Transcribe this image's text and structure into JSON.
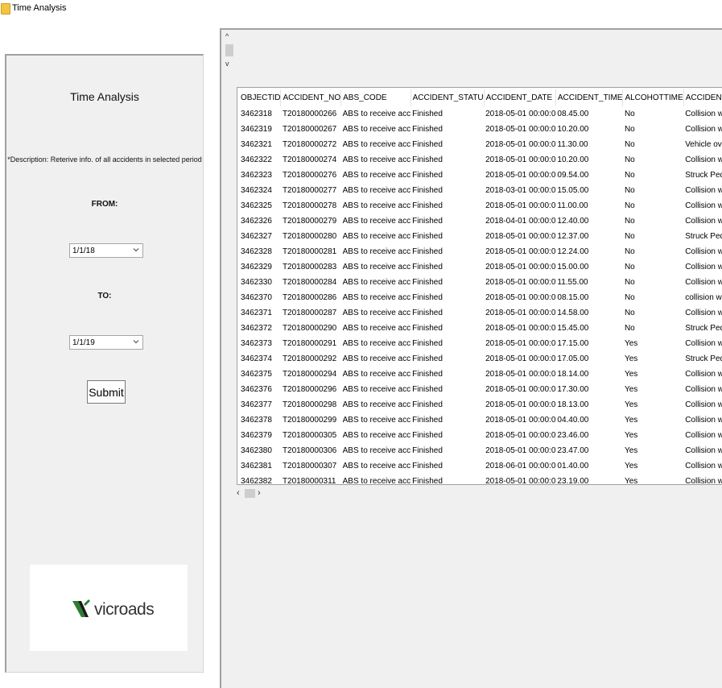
{
  "window": {
    "title": "Time Analysis"
  },
  "left_panel": {
    "title": "Time Analysis",
    "description": "*Description: Reterive info. of all accidents in selected period",
    "from_label": "FROM:",
    "from_value": "1/1/18",
    "to_label": "TO:",
    "to_value": "1/1/19",
    "submit_label": "Submit",
    "logo_text": "vicroads"
  },
  "table": {
    "columns": [
      "OBJECTID",
      "ACCIDENT_NO",
      "ABS_CODE",
      "ACCIDENT_STATU",
      "ACCIDENT_DATE",
      "ACCIDENT_TIME",
      "ALCOHOTTIME",
      "ACCIDENT_TYPE"
    ],
    "rows": [
      [
        "3462318",
        "T20180000266",
        "ABS to receive acc",
        "Finished",
        "2018-05-01 00:00:0",
        "08.45.00",
        "No",
        "Collision with vehi"
      ],
      [
        "3462319",
        "T20180000267",
        "ABS to receive acc",
        "Finished",
        "2018-05-01 00:00:0",
        "10.20.00",
        "No",
        "Collision with vehi"
      ],
      [
        "3462321",
        "T20180000272",
        "ABS to receive acc",
        "Finished",
        "2018-05-01 00:00:0",
        "11.30.00",
        "No",
        "Vehicle overturne"
      ],
      [
        "3462322",
        "T20180000274",
        "ABS to receive acc",
        "Finished",
        "2018-05-01 00:00:0",
        "10.20.00",
        "No",
        "Collision with vehi"
      ],
      [
        "3462323",
        "T20180000276",
        "ABS to receive acc",
        "Finished",
        "2018-05-01 00:00:0",
        "09.54.00",
        "No",
        "Struck Pedestrian"
      ],
      [
        "3462324",
        "T20180000277",
        "ABS to receive acc",
        "Finished",
        "2018-03-01 00:00:0",
        "15.05.00",
        "No",
        "Collision with vehi"
      ],
      [
        "3462325",
        "T20180000278",
        "ABS to receive acc",
        "Finished",
        "2018-05-01 00:00:0",
        "11.00.00",
        "No",
        "Collision with vehi"
      ],
      [
        "3462326",
        "T20180000279",
        "ABS to receive acc",
        "Finished",
        "2018-04-01 00:00:0",
        "12.40.00",
        "No",
        "Collision with a fi"
      ],
      [
        "3462327",
        "T20180000280",
        "ABS to receive acc",
        "Finished",
        "2018-05-01 00:00:0",
        "12.37.00",
        "No",
        "Struck Pedestrian"
      ],
      [
        "3462328",
        "T20180000281",
        "ABS to receive acc",
        "Finished",
        "2018-05-01 00:00:0",
        "12.24.00",
        "No",
        "Collision with vehi"
      ],
      [
        "3462329",
        "T20180000283",
        "ABS to receive acc",
        "Finished",
        "2018-05-01 00:00:0",
        "15.00.00",
        "No",
        "Collision with vehi"
      ],
      [
        "3462330",
        "T20180000284",
        "ABS to receive acc",
        "Finished",
        "2018-05-01 00:00:0",
        "11.55.00",
        "No",
        "Collision with vehi"
      ],
      [
        "3462370",
        "T20180000286",
        "ABS to receive acc",
        "Finished",
        "2018-05-01 00:00:0",
        "08.15.00",
        "No",
        "collision with som"
      ],
      [
        "3462371",
        "T20180000287",
        "ABS to receive acc",
        "Finished",
        "2018-05-01 00:00:0",
        "14.58.00",
        "No",
        "Collision with vehi"
      ],
      [
        "3462372",
        "T20180000290",
        "ABS to receive acc",
        "Finished",
        "2018-05-01 00:00:0",
        "15.45.00",
        "No",
        "Struck Pedestrian"
      ],
      [
        "3462373",
        "T20180000291",
        "ABS to receive acc",
        "Finished",
        "2018-05-01 00:00:0",
        "17.15.00",
        "Yes",
        "Collision with a fi"
      ],
      [
        "3462374",
        "T20180000292",
        "ABS to receive acc",
        "Finished",
        "2018-05-01 00:00:0",
        "17.05.00",
        "Yes",
        "Struck Pedestrian"
      ],
      [
        "3462375",
        "T20180000294",
        "ABS to receive acc",
        "Finished",
        "2018-05-01 00:00:0",
        "18.14.00",
        "Yes",
        "Collision with vehi"
      ],
      [
        "3462376",
        "T20180000296",
        "ABS to receive acc",
        "Finished",
        "2018-05-01 00:00:0",
        "17.30.00",
        "Yes",
        "Collision with vehi"
      ],
      [
        "3462377",
        "T20180000298",
        "ABS to receive acc",
        "Finished",
        "2018-05-01 00:00:0",
        "18.13.00",
        "Yes",
        "Collision with vehi"
      ],
      [
        "3462378",
        "T20180000299",
        "ABS to receive acc",
        "Finished",
        "2018-05-01 00:00:0",
        "04.40.00",
        "Yes",
        "Collision with vehi"
      ],
      [
        "3462379",
        "T20180000305",
        "ABS to receive acc",
        "Finished",
        "2018-05-01 00:00:0",
        "23.46.00",
        "Yes",
        "Collision with vehi"
      ],
      [
        "3462380",
        "T20180000306",
        "ABS to receive acc",
        "Finished",
        "2018-05-01 00:00:0",
        "23.47.00",
        "Yes",
        "Collision with a fi"
      ],
      [
        "3462381",
        "T20180000307",
        "ABS to receive acc",
        "Finished",
        "2018-06-01 00:00:0",
        "01.40.00",
        "Yes",
        "Collision with a fi"
      ],
      [
        "3462382",
        "T20180000311",
        "ABS to receive acc",
        "Finished",
        "2018-05-01 00:00:0",
        "23.19.00",
        "Yes",
        "Collision with vehi"
      ]
    ]
  },
  "icons": {
    "window": "folder-icon",
    "scroll_up": "chevron-up-icon",
    "scroll_down": "chevron-down-icon",
    "scroll_left": "chevron-left-icon",
    "scroll_right": "chevron-right-icon",
    "combo": "chevron-down-icon"
  },
  "colors": {
    "panel_bg": "#f0f0f0",
    "logo_green": "#2e7d32"
  }
}
